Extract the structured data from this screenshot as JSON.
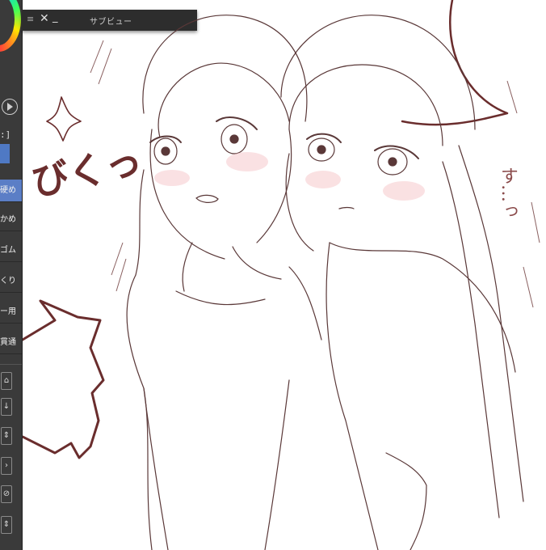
{
  "tool_panel": {
    "bracket_label": ":]",
    "brush_items": [
      {
        "label": "硬め",
        "active": true
      },
      {
        "label": "かめ",
        "active": false
      },
      {
        "label": "ゴム",
        "active": false
      },
      {
        "label": "くり",
        "active": false
      },
      {
        "label": "ー用",
        "active": false
      },
      {
        "label": "貫通",
        "active": false
      }
    ]
  },
  "subview": {
    "menu_icon": "≡",
    "close_icon": "✕",
    "minimize_icon": "_",
    "title": "サブビュー"
  },
  "artwork": {
    "sfx_main": "びくっ",
    "sfx_side": "す…っ",
    "line_color": "#6a2d2d"
  }
}
